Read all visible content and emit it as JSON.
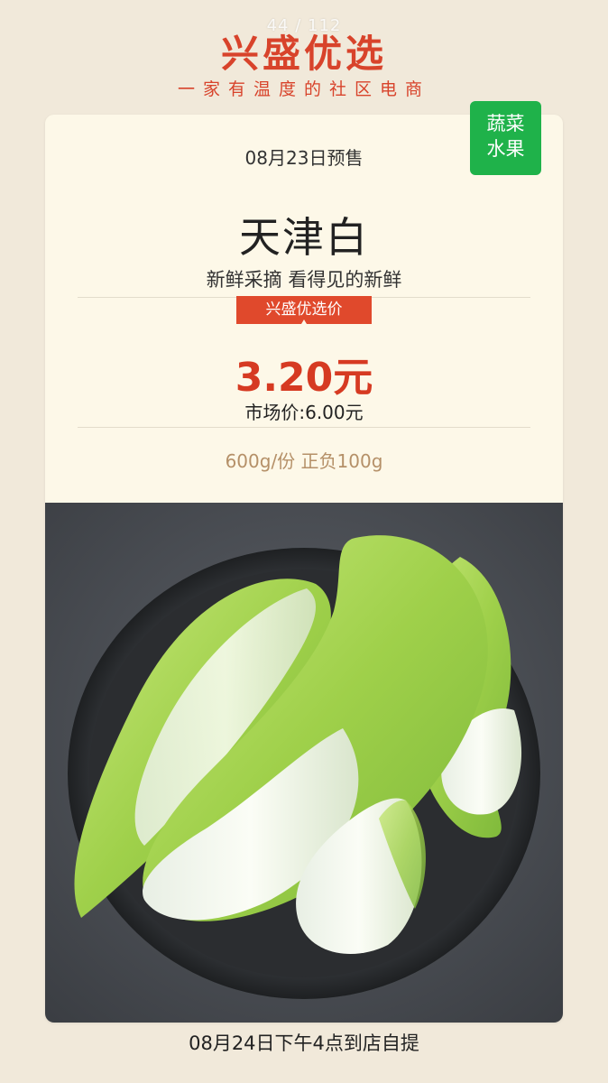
{
  "header": {
    "counter": "44 / 112",
    "brand": "兴盛优选",
    "slogan": "一家有温度的社区电商"
  },
  "category_badge": {
    "line1": "蔬菜",
    "line2": "水果"
  },
  "product": {
    "presale": "08月23日预售",
    "name": "天津白",
    "tagline": "新鲜采摘 看得见的新鲜",
    "price_tag": "兴盛优选价",
    "price": "3.20元",
    "market_price": "市场价:6.00元",
    "spec": "600g/份 正负100g"
  },
  "footer": {
    "pickup": "08月24日下午4点到店自提"
  },
  "colors": {
    "brand_red": "#d8432b",
    "price_red": "#d63a22",
    "badge_green": "#1fb24a",
    "background": "#f1e9da",
    "card": "#fdf8e8"
  }
}
